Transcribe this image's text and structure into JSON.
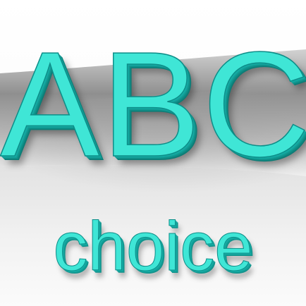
{
  "logo": {
    "headline": "ABC",
    "tagline": "choice"
  },
  "colors": {
    "letter_face": "#3fe6d6",
    "letter_edge": "#0d8d88",
    "backdrop_shadow": "#8a8a8a",
    "backdrop_light": "#f4f4f4"
  }
}
